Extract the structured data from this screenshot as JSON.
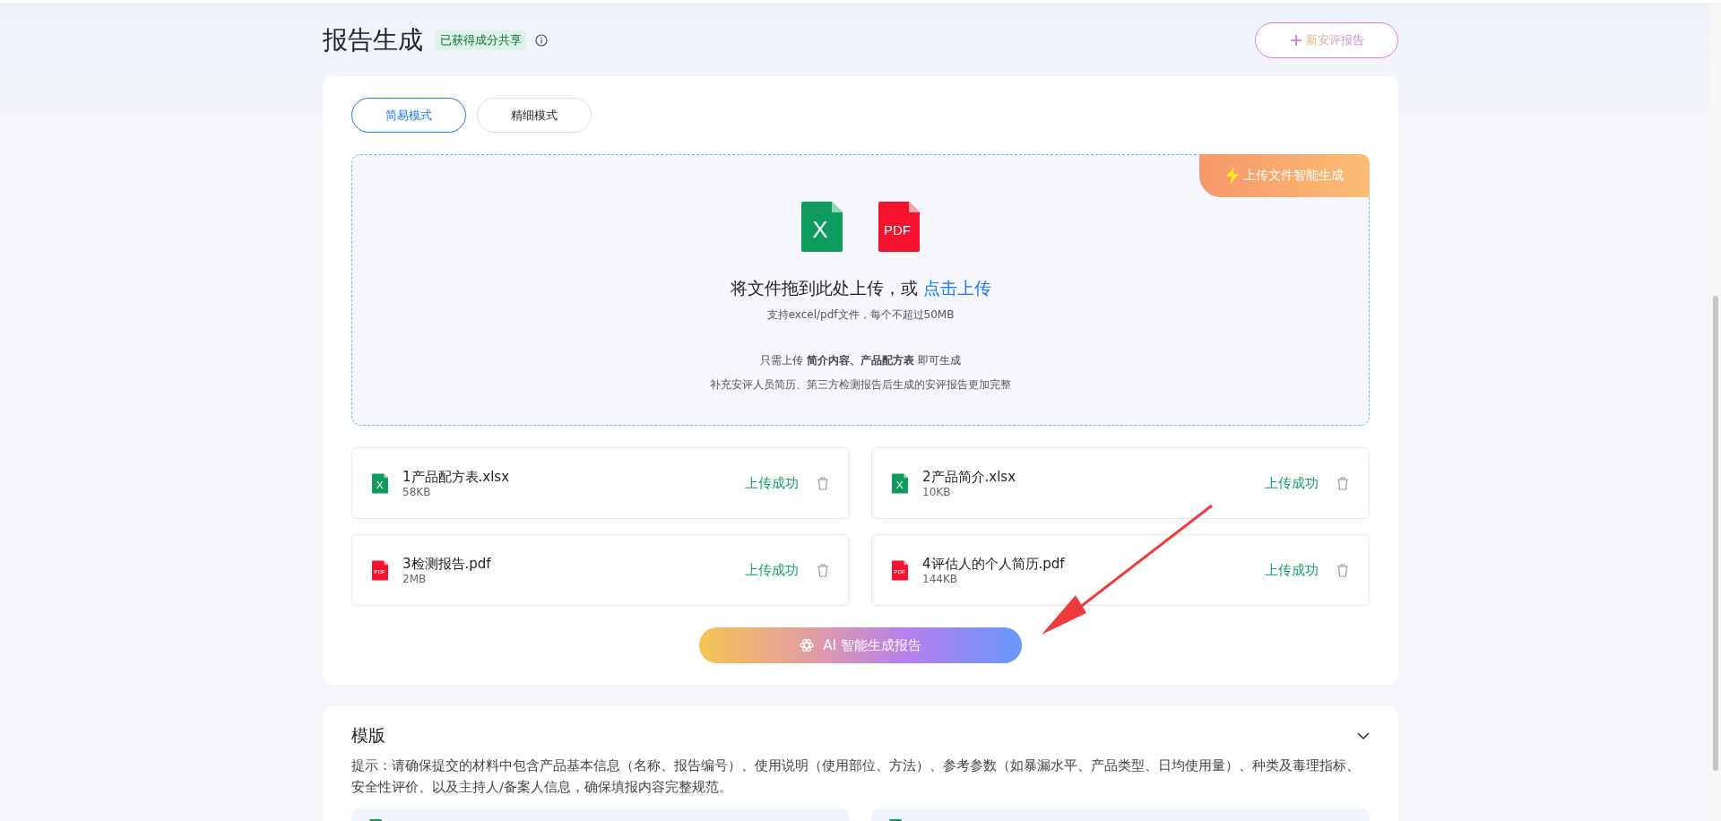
{
  "page": {
    "title": "报告生成",
    "badge": "已获得成分共享",
    "new_button": "新安评报告"
  },
  "modes": [
    {
      "label": "简易模式",
      "selected": true
    },
    {
      "label": "精细模式",
      "selected": false
    }
  ],
  "upload": {
    "corner_tag": "上传文件智能生成",
    "file_types": [
      {
        "kind": "excel",
        "label": "X"
      },
      {
        "kind": "pdf",
        "label": "PDF"
      }
    ],
    "prompt": "将文件拖到此处上传，或",
    "link": "点击上传",
    "hint": "支持excel/pdf文件，每个不超过50MB",
    "requirement": "只需上传 **简介内容、产品配方表** 即可生成",
    "note": "补充安评人员简历、第三方检测报告后生成的安评报告更加完整"
  },
  "files": [
    {
      "kind": "excel",
      "icon_label": "X",
      "name": "1产品配方表.xlsx",
      "size": "58KB",
      "status": "上传成功"
    },
    {
      "kind": "excel",
      "icon_label": "X",
      "name": "2产品简介.xlsx",
      "size": "10KB",
      "status": "上传成功"
    },
    {
      "kind": "pdf",
      "icon_label": "PDF",
      "name": "3检测报告.pdf",
      "size": "2MB",
      "status": "上传成功"
    },
    {
      "kind": "pdf",
      "icon_label": "PDF",
      "name": "4评估人的个人简历.pdf",
      "size": "144KB",
      "status": "上传成功"
    }
  ],
  "generate_button": "AI 智能生成报告",
  "template": {
    "title": "模版",
    "expanded": true,
    "tip": "提示：请确保提交的材料中包含产品基本信息（名称、报告编号）、使用说明（使用部位、方法）、参考参数（如暴漏水平、产品类型、日均使用量）、种类及毒理指标、安全性评价、以及主持人/备案人信息，确保填报内容完整规范。"
  }
}
